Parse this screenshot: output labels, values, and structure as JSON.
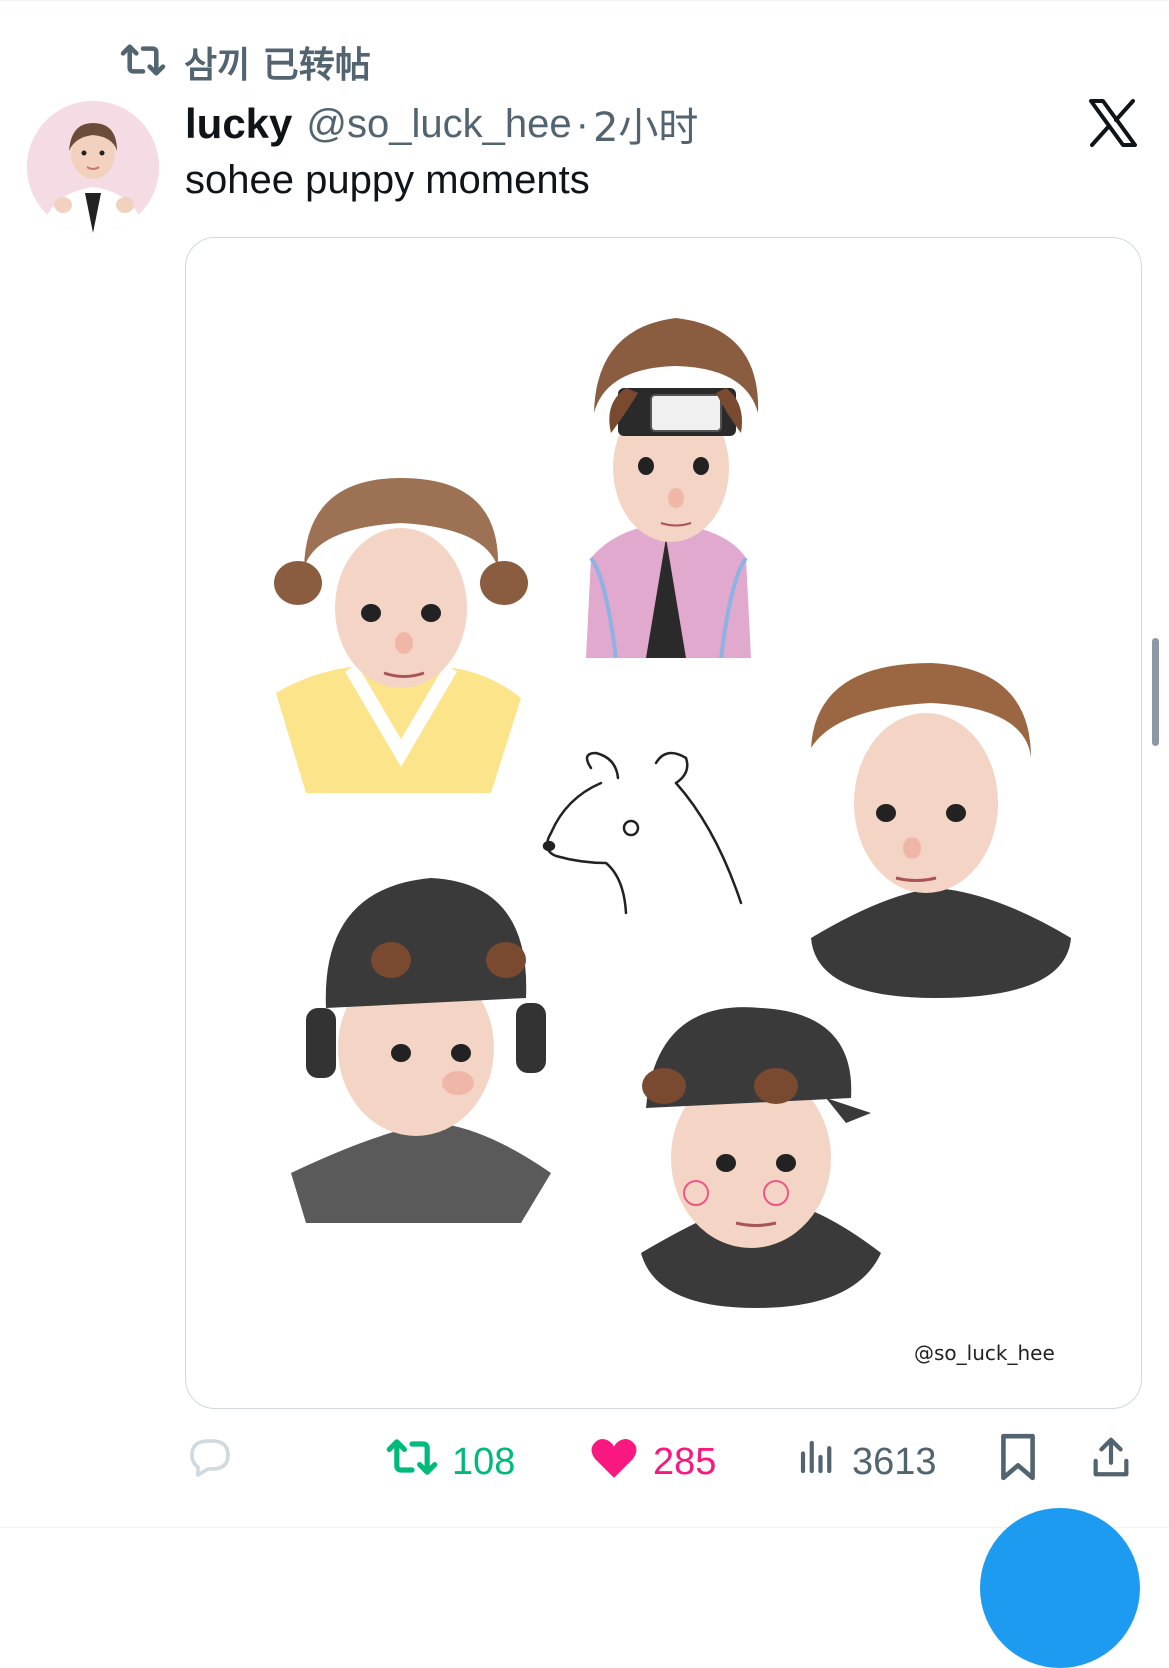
{
  "repost": {
    "label": "삼끼 已转帖"
  },
  "author": {
    "name": "lucky",
    "handle": "@so_luck_hee",
    "separator": "·",
    "time": "2小时"
  },
  "tweet": {
    "text": "sohee puppy moments"
  },
  "media": {
    "watermark": "@so_luck_hee"
  },
  "actions": {
    "retweets": "108",
    "likes": "285",
    "views": "3613"
  },
  "colors": {
    "retweet": "#00ba7c",
    "like": "#f91880",
    "muted": "#536471",
    "accent": "#1d9bf0"
  }
}
